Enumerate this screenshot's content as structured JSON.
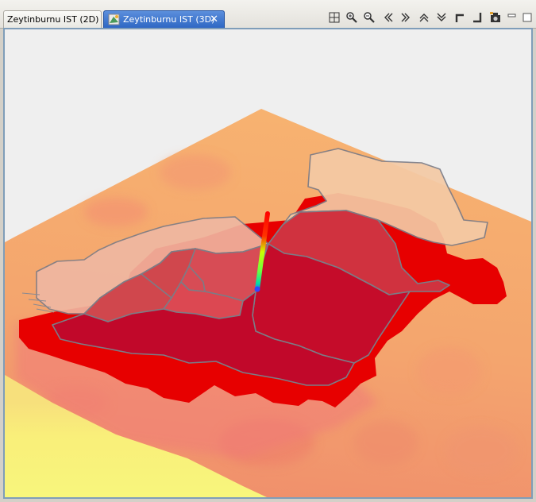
{
  "tabs": [
    {
      "label": "Zeytinburnu IST (2D)",
      "active": false
    },
    {
      "label": "Zeytinburnu IST (3D)",
      "active": true
    }
  ],
  "close_icon_glyph": "✕",
  "toolbar": {
    "icons": [
      "zoom-extent-icon",
      "zoom-in-icon",
      "zoom-out-icon",
      "pan-left-icon",
      "pan-right-icon",
      "pan-up-icon",
      "pan-down-icon",
      "tilt-up-icon",
      "tilt-down-icon",
      "snapshot-camera-icon",
      "minimize-icon",
      "maximize-icon"
    ]
  },
  "colors": {
    "sky": "#efefef",
    "terrain_orange": "#f5a86d",
    "terrain_yellow": "#f8f47a",
    "flood_red": "#e80000",
    "district_dark": "#c30a2a",
    "district_mid": "#d33a47",
    "district_light": "#f4cba6",
    "boundary": "#7c7c86",
    "active_tab": "#3a72cf"
  },
  "scene": {
    "vertical_bar_gradient": [
      "#ff0000",
      "#ffcc00",
      "#99ff00",
      "#00ff99",
      "#3344ff"
    ]
  }
}
